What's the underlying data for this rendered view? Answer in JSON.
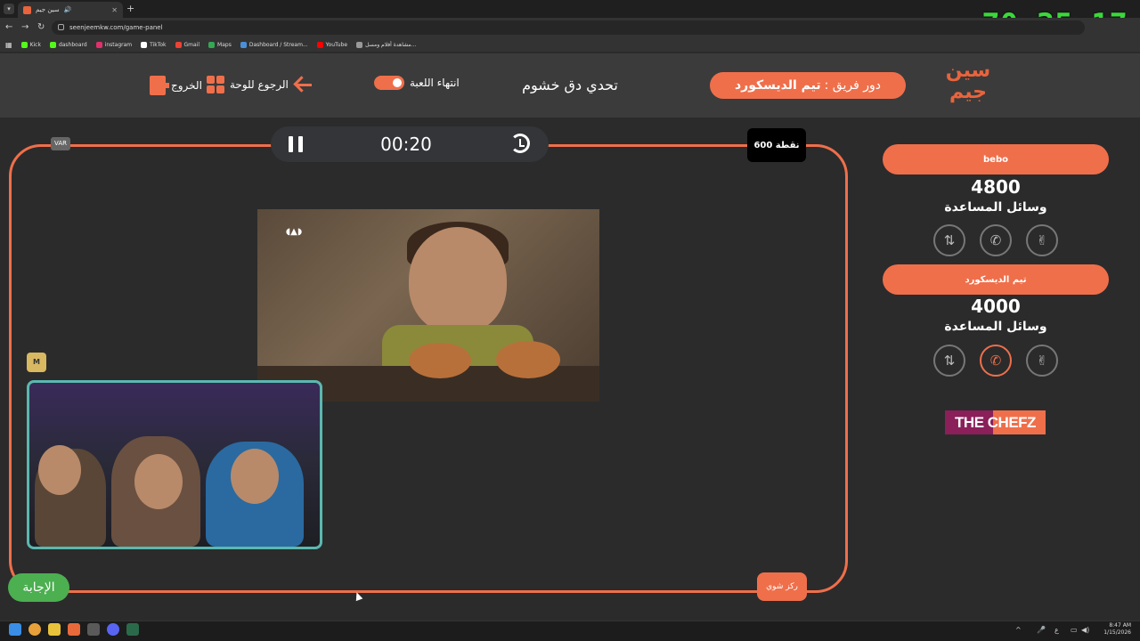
{
  "browser": {
    "tab_title": "سين جيم",
    "url": "seenjeemkw.com/game-panel",
    "bookmarks": [
      {
        "label": "Kick",
        "color": "#53fc18"
      },
      {
        "label": "dashboard",
        "color": "#53fc18"
      },
      {
        "label": "instagram",
        "color": "#e1306c"
      },
      {
        "label": "TikTok",
        "color": "#ffffff"
      },
      {
        "label": "Gmail",
        "color": "#ea4335"
      },
      {
        "label": "Maps",
        "color": "#34a853"
      },
      {
        "label": "Dashboard / Stream...",
        "color": "#4a90d9"
      },
      {
        "label": "YouTube",
        "color": "#ff0000"
      },
      {
        "label": "مشاهدة أفلام ومسل...",
        "color": "#999999"
      }
    ]
  },
  "overlay_timer": "70:35:17",
  "header": {
    "logo_text": "سين جيم",
    "turn_label": "دور فريق :",
    "turn_team": "تيم الديسكورد",
    "game_title": "تحدي دق خشوم",
    "end_game_label": "انتهاء اللعبة",
    "back_to_board_label": "الرجوع للوحة",
    "exit_label": "الخروج"
  },
  "board": {
    "timer": "00:20",
    "var_label": "VAR",
    "points_label": "600 نقطة",
    "answer_button": "الإجابة",
    "shot_button": "ركز شوي"
  },
  "teams": [
    {
      "name": "bebo",
      "score": "4800",
      "help_title": "وسائل المساعدة",
      "help_icons": [
        "two-fingers-icon",
        "phone-icon",
        "hand-swap-icon"
      ],
      "active_help": null
    },
    {
      "name": "تيم الديسكورد",
      "score": "4000",
      "help_title": "وسائل المساعدة",
      "help_icons": [
        "two-fingers-icon",
        "phone-icon",
        "hand-swap-icon"
      ],
      "active_help": "phone-icon"
    }
  ],
  "sponsor": "THE CHEFZ",
  "taskbar": {
    "time": "8:47 AM",
    "date": "1/15/2026",
    "lang": "ع"
  },
  "colors": {
    "accent": "#ef6f4b",
    "answer": "#4caf50",
    "overlay_timer": "#3ad83a"
  }
}
